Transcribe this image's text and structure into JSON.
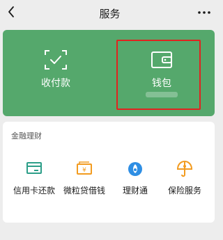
{
  "header": {
    "title": "服务"
  },
  "top_services": [
    {
      "label": "收付款",
      "icon": "scan-pay-icon"
    },
    {
      "label": "钱包",
      "icon": "wallet-icon"
    }
  ],
  "colors": {
    "green_card": "#55a86c",
    "highlight": "#e1231f",
    "cyan_icon": "#2c9e88",
    "orange_icon": "#f29b1f",
    "blue_icon": "#2e8ee4"
  },
  "finance": {
    "section_title": "金融理财",
    "items": [
      {
        "label": "信用卡还款",
        "icon": "credit-card-icon"
      },
      {
        "label": "微粒贷借钱",
        "icon": "yuan-bill-icon"
      },
      {
        "label": "理财通",
        "icon": "licaitong-icon"
      },
      {
        "label": "保险服务",
        "icon": "umbrella-icon"
      }
    ]
  }
}
